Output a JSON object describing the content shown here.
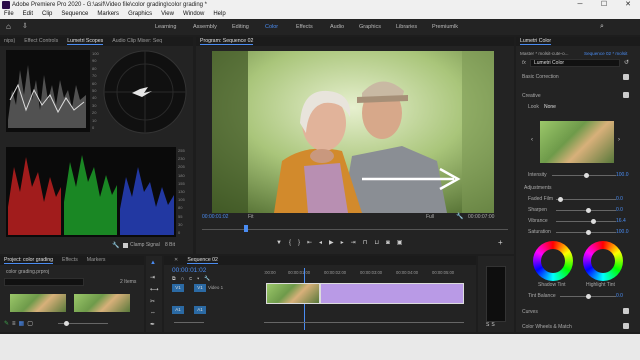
{
  "app": {
    "title": "Adobe Premiere Pro 2020 - G:\\asif\\Video file\\color grading\\color grading *"
  },
  "window": {
    "minimize": "─",
    "maximize": "☐",
    "close": "✕"
  },
  "menu": [
    "File",
    "Edit",
    "Clip",
    "Sequence",
    "Markers",
    "Graphics",
    "View",
    "Window",
    "Help"
  ],
  "workspaces": [
    "Learning",
    "Assembly",
    "Editing",
    "Color",
    "Effects",
    "Audio",
    "Graphics",
    "Libraries",
    "Premiumlk"
  ],
  "active_workspace": "Color",
  "left_panel": {
    "tabs": [
      "nips)",
      "Effect Controls",
      "Lumetri Scopes",
      "Audio Clip Mixer: Seq"
    ],
    "scale_top": [
      "100",
      "90",
      "80",
      "70",
      "60",
      "50",
      "40",
      "30",
      "20",
      "10",
      "0"
    ],
    "scale_bottom": [
      "255",
      "230",
      "205",
      "180",
      "155",
      "130",
      "105",
      "80",
      "55",
      "30",
      "0"
    ],
    "clamp_label": "Clamp Signal",
    "bits_label": "8 Bit"
  },
  "program": {
    "title": "Program: Sequence 02",
    "timecode": "00:00:01:02",
    "fit": "Fit",
    "quality": "Full",
    "duration": "00:00:07:00"
  },
  "project": {
    "tabs": [
      "Project: color grading",
      "Effects",
      "Markers"
    ],
    "filename": "color grading.prproj",
    "count": "2 Items"
  },
  "timeline": {
    "tab": "Sequence 02",
    "timecode": "00:00:01:02",
    "ruler": [
      ":00:00",
      "00:00:01:00",
      "00:00:02:00",
      "00:00:03:00",
      "00:00:04:00",
      "00:00:05:00"
    ],
    "tracks": {
      "v1": "V1",
      "v1b": "V1",
      "video_label": "Video 1",
      "a1": "A1",
      "a1b": "A1"
    }
  },
  "lumetri": {
    "tab": "Lumetri Color",
    "master": "Master * molsit-cute-o...",
    "sequence": "Sequence 02 * molsit",
    "fx": "fx",
    "effect": "Lumetri Color",
    "sections": {
      "basic": "Basic Correction",
      "creative": "Creative",
      "look_label": "Look",
      "look_value": "None",
      "adjustments": "Adjustments",
      "curves": "Curves",
      "wheels": "Color Wheels & Match"
    },
    "intensity": {
      "label": "Intensity",
      "value": "100.0"
    },
    "sliders": [
      {
        "label": "Faded Film",
        "value": "0.0"
      },
      {
        "label": "Sharpen",
        "value": "0.0"
      },
      {
        "label": "Vibrance",
        "value": "16.4"
      },
      {
        "label": "Saturation",
        "value": "100.0"
      }
    ],
    "shadow_tint": "Shadow Tint",
    "highlight_tint": "Highlight Tint",
    "tint_balance": {
      "label": "Tint Balance",
      "value": "0.0"
    }
  },
  "colors": {
    "accent": "#4a8cf2",
    "clip_purple": "#b99ae6",
    "track_blue": "#2b6aa4"
  }
}
